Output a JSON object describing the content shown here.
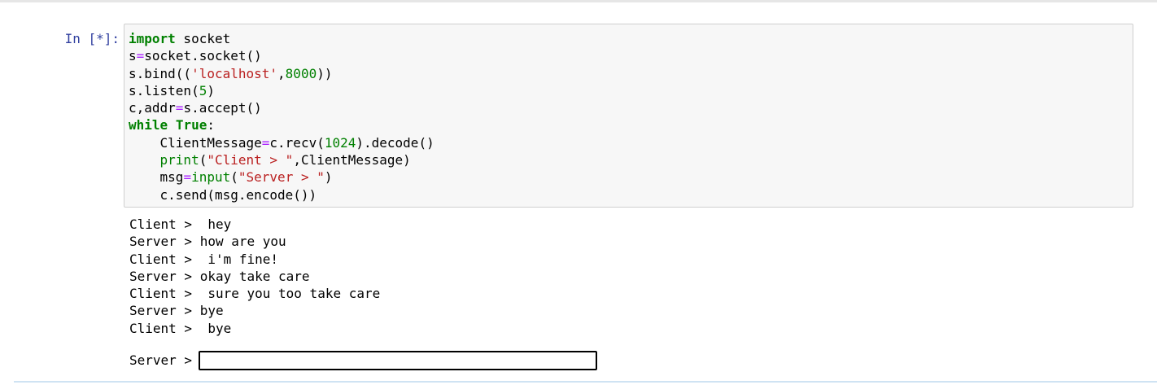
{
  "cell": {
    "prompt": "In [*]:",
    "code_lines": [
      [
        {
          "t": "import",
          "c": "kw"
        },
        {
          "t": " socket",
          "c": ""
        }
      ],
      [
        {
          "t": "s",
          "c": ""
        },
        {
          "t": "=",
          "c": "op"
        },
        {
          "t": "socket.socket()",
          "c": ""
        }
      ],
      [
        {
          "t": "s.bind((",
          "c": ""
        },
        {
          "t": "'localhost'",
          "c": "str"
        },
        {
          "t": ",",
          "c": ""
        },
        {
          "t": "8000",
          "c": "num"
        },
        {
          "t": "))",
          "c": ""
        }
      ],
      [
        {
          "t": "s.listen(",
          "c": ""
        },
        {
          "t": "5",
          "c": "num"
        },
        {
          "t": ")",
          "c": ""
        }
      ],
      [
        {
          "t": "c,addr",
          "c": ""
        },
        {
          "t": "=",
          "c": "op"
        },
        {
          "t": "s.accept()",
          "c": ""
        }
      ],
      [
        {
          "t": "while",
          "c": "kw"
        },
        {
          "t": " ",
          "c": ""
        },
        {
          "t": "True",
          "c": "kw"
        },
        {
          "t": ":",
          "c": ""
        }
      ],
      [
        {
          "t": "    ClientMessage",
          "c": ""
        },
        {
          "t": "=",
          "c": "op"
        },
        {
          "t": "c.recv(",
          "c": ""
        },
        {
          "t": "1024",
          "c": "num"
        },
        {
          "t": ").decode()",
          "c": ""
        }
      ],
      [
        {
          "t": "    ",
          "c": ""
        },
        {
          "t": "print",
          "c": "builtin"
        },
        {
          "t": "(",
          "c": ""
        },
        {
          "t": "\"Client > \"",
          "c": "str"
        },
        {
          "t": ",ClientMessage)",
          "c": ""
        }
      ],
      [
        {
          "t": "    msg",
          "c": ""
        },
        {
          "t": "=",
          "c": "op"
        },
        {
          "t": "input",
          "c": "builtin"
        },
        {
          "t": "(",
          "c": ""
        },
        {
          "t": "\"Server > \"",
          "c": "str"
        },
        {
          "t": ")",
          "c": ""
        }
      ],
      [
        {
          "t": "    c.send(msg.encode())",
          "c": ""
        }
      ]
    ],
    "output_lines": [
      "Client >  hey",
      "Server > how are you",
      "Client >  i'm fine!",
      "Server > okay take care",
      "Client >  sure you too take care",
      "Server > bye",
      "Client >  bye"
    ],
    "stdin": {
      "label": "Server >",
      "value": ""
    }
  },
  "colors": {
    "prompt": "#303f9f",
    "keyword": "#008000",
    "operator": "#aa22ff",
    "string": "#ba2121",
    "number": "#008000",
    "input_bg": "#f7f7f7"
  }
}
